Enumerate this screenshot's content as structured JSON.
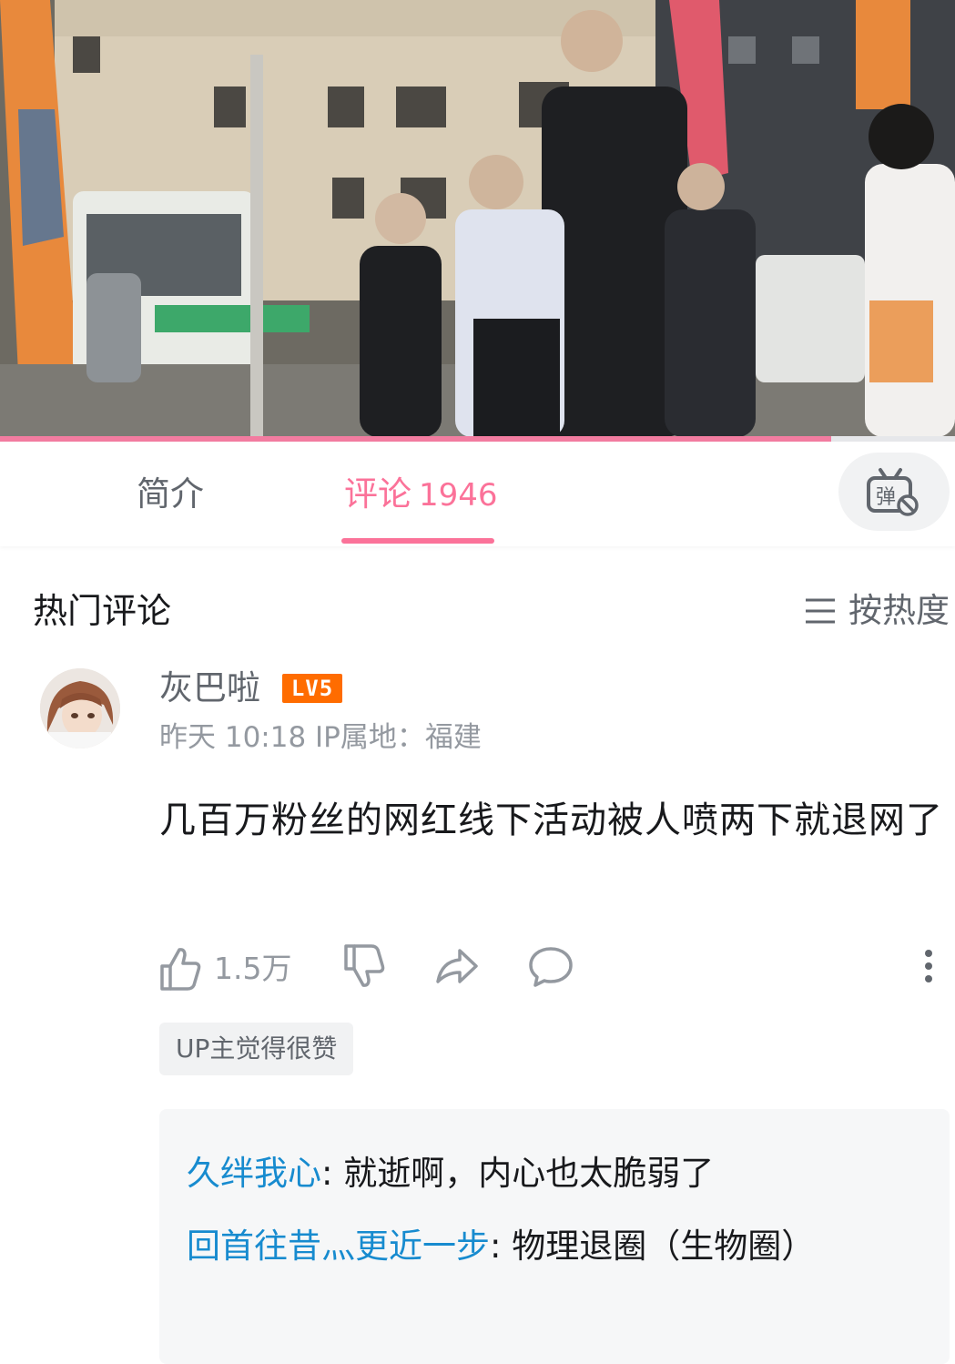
{
  "video": {
    "progress": 0.87,
    "progress_color": "#f27ca0"
  },
  "tabs": {
    "intro_label": "简介",
    "comments_label": "评论",
    "comments_count": "1946",
    "active_color": "#fb7299",
    "danmaku_icon": "danmaku-off-icon"
  },
  "section": {
    "title": "热门评论",
    "sort_label": "按热度",
    "sort_icon": "menu-icon"
  },
  "comment": {
    "username": "灰巴啦",
    "level": "LV5",
    "meta": "昨天 10:18  IP属地：福建",
    "text": "几百万粉丝的网红线下活动被人喷两下就退网了",
    "like_count": "1.5万",
    "up_tag": "UP主觉得很赞",
    "replies": [
      {
        "name": "久绊我心",
        "text": "就逝啊，内心也太脆弱了"
      },
      {
        "name": "回首往昔灬更近一步",
        "text": "物理退圈（生物圈）"
      }
    ]
  },
  "colors": {
    "link_blue": "#178bcf",
    "level_orange": "#ff6c00",
    "muted_text": "#9499a0"
  }
}
